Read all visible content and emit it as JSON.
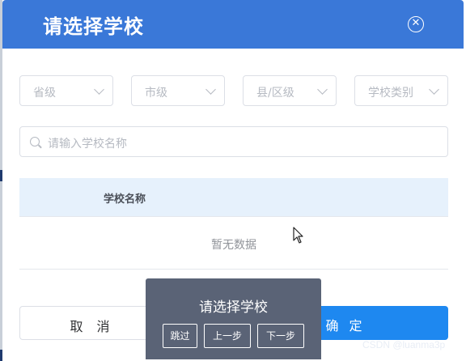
{
  "dialog": {
    "title": "请选择学校",
    "close_icon": "close-circle-icon"
  },
  "filters": [
    {
      "placeholder": "省级"
    },
    {
      "placeholder": "市级"
    },
    {
      "placeholder": "县/区级"
    },
    {
      "placeholder": "学校类别"
    }
  ],
  "search": {
    "placeholder": "请输入学校名称",
    "icon": "search-icon"
  },
  "table": {
    "columns": [
      "学校名称"
    ],
    "empty_text": "暂无数据"
  },
  "footer": {
    "cancel_label": "取 消",
    "confirm_label": "确 定"
  },
  "tour": {
    "title": "请选择学校",
    "skip_label": "跳过",
    "prev_label": "上一步",
    "next_label": "下一步"
  },
  "watermark": "CSDN @luanma3p",
  "colors": {
    "header": "#3a78d8",
    "primary": "#1e88f0",
    "table_header": "#e6f1fc",
    "tour_bg": "#5a6376"
  }
}
